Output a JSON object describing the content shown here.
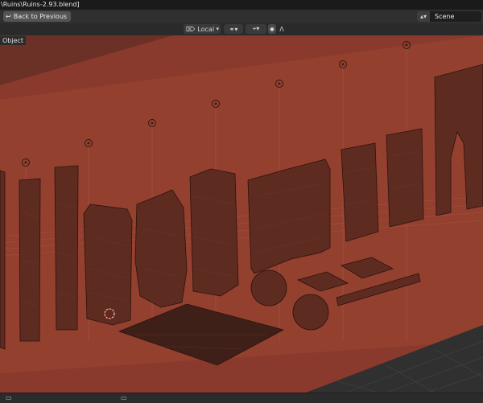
{
  "window": {
    "title_path": "\\Ruins\\Ruins-2.93.blend]"
  },
  "topbar": {
    "back_label": "Back to Previous",
    "scene_label": "Scene"
  },
  "viewport_header": {
    "orientation": "Local"
  },
  "viewport": {
    "mode_label": "Object",
    "colors": {
      "background": "#8a3a2c",
      "wall": "#97402f",
      "floor_grid": "#3a3a3a",
      "mesh": "#5a2a20"
    }
  },
  "icons": {
    "back": "back-arrow-icon",
    "scene": "scene-icon",
    "pivot": "pivot-icon",
    "snap": "snap-icon",
    "proportional": "proportional-edit-icon",
    "falloff": "falloff-curve-icon",
    "light": "light-empty-icon"
  }
}
